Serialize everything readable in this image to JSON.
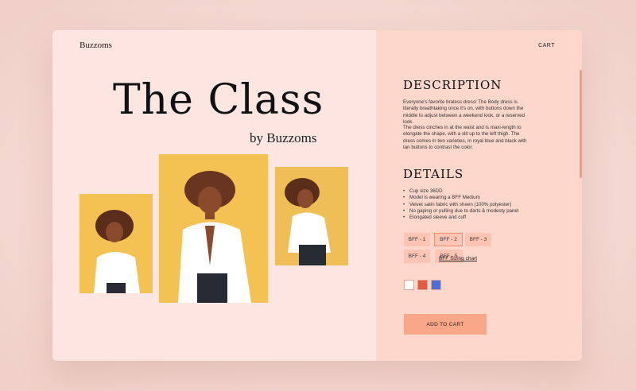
{
  "brand": "Buzzoms",
  "hero": {
    "title": "The Class",
    "subtitle": "by Buzzoms"
  },
  "nav": {
    "cart_label": "CART"
  },
  "description": {
    "title": "DESCRIPTION",
    "paragraphs": [
      "Everyone's favorite braless dress! The Body dress is literally breathtaking once it's on, with buttons down the middle to adjust between a weekend look, or a reserved look.",
      "The dress cinches in at the waist and is maxi-length to elongate the shape, with a slit up to the left thigh. The dress comes in two varieties, in royal blue and black with tan buttons to contrast the color."
    ]
  },
  "details": {
    "title": "DETAILS",
    "items": [
      "Cup size 36DD",
      "Model is wearing a BFF Medium",
      "Velvet satin fabric with sheen (100% polyester)",
      "No gaping or pulling due to darts & modesty panel",
      "Elongated sleeve and cuff"
    ]
  },
  "sizes": {
    "options": [
      "BFF - 1",
      "BFF - 2",
      "BFF - 3",
      "BFF - 4",
      "BFF - 5"
    ],
    "selected": "BFF - 2",
    "chart_link": "BFF Sizing chart"
  },
  "colors": {
    "swatches": [
      "#ffffff",
      "#e25c43",
      "#4b6ee0"
    ]
  },
  "add_to_cart_label": "ADD TO CART",
  "theme": {
    "left_bg": "#fde6e1",
    "right_bg": "#fdd7cc",
    "accent": "#f9a689",
    "photo_bg": "#f4c153"
  }
}
